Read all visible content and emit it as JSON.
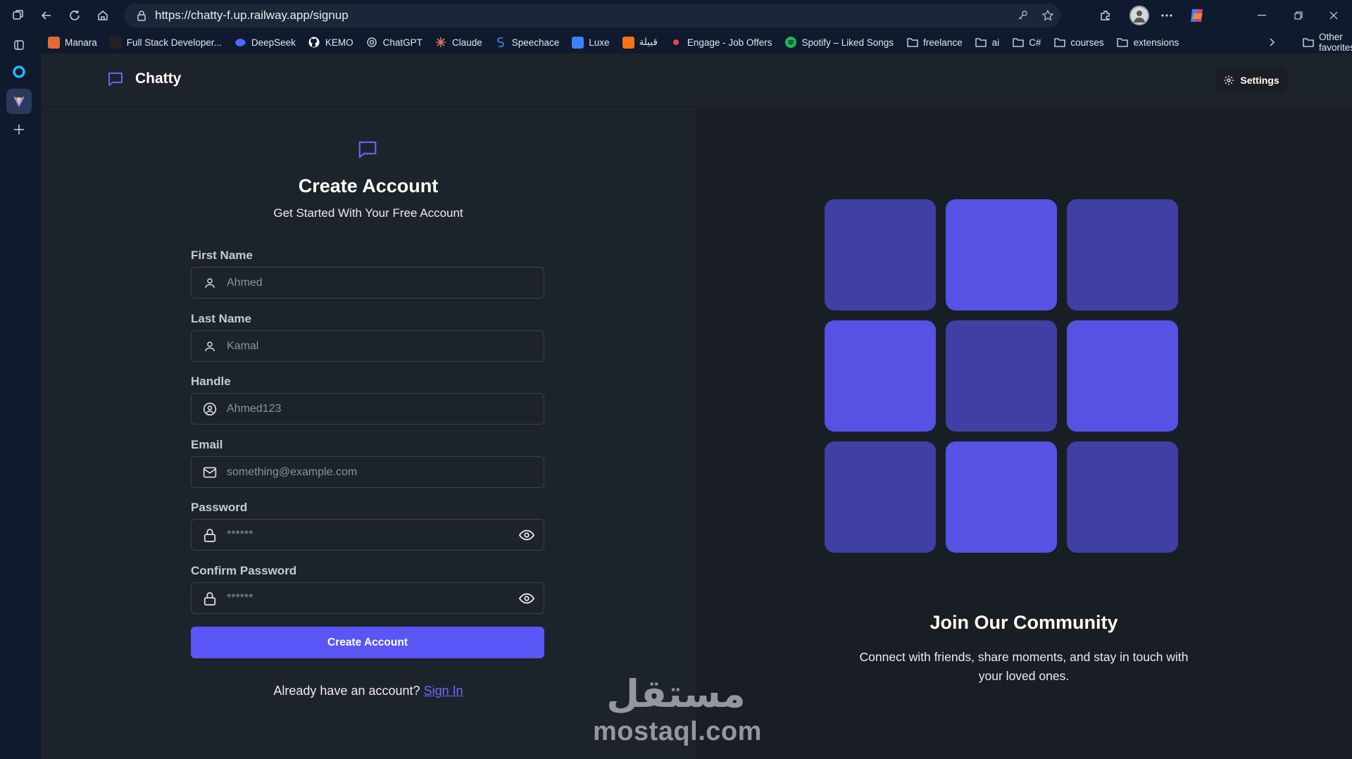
{
  "browser": {
    "url": "https://chatty-f.up.railway.app/signup",
    "bookmarks": [
      {
        "label": "Manara",
        "icon": "manara-icon",
        "color": "#e06a3a"
      },
      {
        "label": "Full Stack Developer...",
        "icon": "r-icon",
        "color": "#222222"
      },
      {
        "label": "DeepSeek",
        "icon": "deepseek-icon",
        "color": "#4d6bfe"
      },
      {
        "label": "KEMO",
        "icon": "github-icon",
        "color": "#ffffff"
      },
      {
        "label": "ChatGPT",
        "icon": "chatgpt-icon",
        "color": "#cccccc"
      },
      {
        "label": "Claude",
        "icon": "claude-icon",
        "color": "#d97757"
      },
      {
        "label": "Speechace",
        "icon": "speechace-icon",
        "color": "#4a8cff"
      },
      {
        "label": "Luxe",
        "icon": "luxe-icon",
        "color": "#3b82f6"
      },
      {
        "label": "قبيلة",
        "icon": "qabila-icon",
        "color": "#f97316"
      },
      {
        "label": "Engage - Job Offers",
        "icon": "engage-icon",
        "color": "#ef4444"
      },
      {
        "label": "Spotify – Liked Songs",
        "icon": "spotify-icon",
        "color": "#1db954"
      },
      {
        "label": "freelance",
        "icon": "folder-icon"
      },
      {
        "label": "ai",
        "icon": "folder-icon"
      },
      {
        "label": "C#",
        "icon": "folder-icon"
      },
      {
        "label": "courses",
        "icon": "folder-icon"
      },
      {
        "label": "extensions",
        "icon": "folder-icon"
      }
    ],
    "other_favorites": "Other favorites"
  },
  "app": {
    "brand": "Chatty",
    "settings_label": "Settings",
    "form": {
      "title": "Create Account",
      "subtitle": "Get Started With Your Free Account",
      "fields": {
        "first_name": {
          "label": "First Name",
          "placeholder": "Ahmed"
        },
        "last_name": {
          "label": "Last Name",
          "placeholder": "Kamal"
        },
        "handle": {
          "label": "Handle",
          "placeholder": "Ahmed123"
        },
        "email": {
          "label": "Email",
          "placeholder": "something@example.com"
        },
        "password": {
          "label": "Password",
          "placeholder": "******"
        },
        "confirm_password": {
          "label": "Confirm Password",
          "placeholder": "******"
        }
      },
      "submit_label": "Create Account",
      "signin_prompt": "Already have an account?",
      "signin_link": "Sign In"
    },
    "community": {
      "title": "Join Our Community",
      "text": "Connect with friends, share moments, and stay in touch with your loved ones."
    },
    "accent_color": "#5a55f5"
  },
  "watermark": {
    "arabic": "مستقل",
    "latin": "mostaql.com"
  }
}
